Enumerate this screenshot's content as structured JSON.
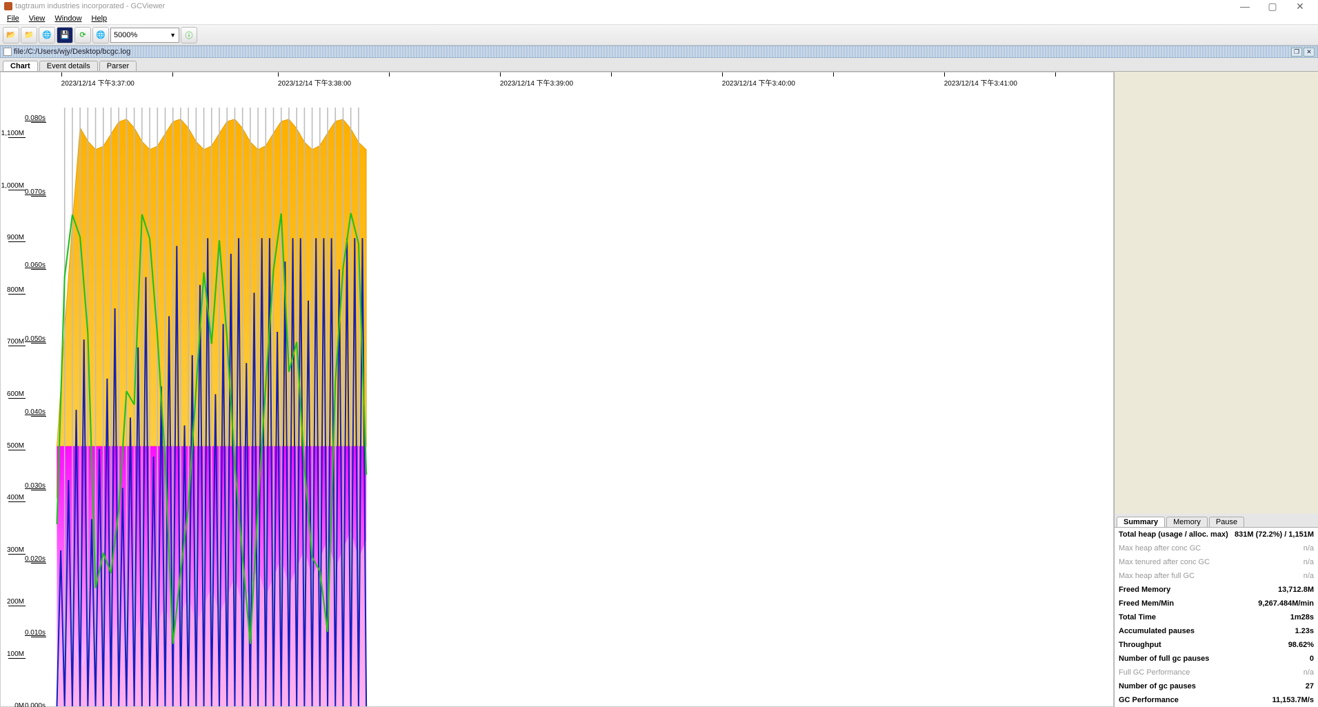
{
  "window": {
    "title": "tagtraum industries incorporated - GCViewer"
  },
  "menu": {
    "file": "File",
    "view": "View",
    "window": "Window",
    "help": "Help"
  },
  "toolbar": {
    "zoom_value": "5000%"
  },
  "subwin": {
    "path": "file:/C:/Users/wjy/Desktop/bcgc.log"
  },
  "chart_tabs": {
    "chart": "Chart",
    "event_details": "Event details",
    "parser": "Parser"
  },
  "right_tabs": {
    "summary": "Summary",
    "memory": "Memory",
    "pause": "Pause"
  },
  "summary": {
    "rows": [
      {
        "k": "Total heap (usage / alloc. max)",
        "v": "831M (72.2%) / 1,151M",
        "dim": false
      },
      {
        "k": "Max heap after conc GC",
        "v": "n/a",
        "dim": true
      },
      {
        "k": "Max tenured after conc GC",
        "v": "n/a",
        "dim": true
      },
      {
        "k": "Max heap after full GC",
        "v": "n/a",
        "dim": true
      },
      {
        "k": "Freed Memory",
        "v": "13,712.8M",
        "dim": false
      },
      {
        "k": "Freed Mem/Min",
        "v": "9,267.484M/min",
        "dim": false
      },
      {
        "k": "Total Time",
        "v": "1m28s",
        "dim": false
      },
      {
        "k": "Accumulated pauses",
        "v": "1.23s",
        "dim": false
      },
      {
        "k": "Throughput",
        "v": "98.62%",
        "dim": false
      },
      {
        "k": "Number of full gc pauses",
        "v": "0",
        "dim": false
      },
      {
        "k": "Full GC Performance",
        "v": "n/a",
        "dim": true
      },
      {
        "k": "Number of gc pauses",
        "v": "27",
        "dim": false
      },
      {
        "k": "GC Performance",
        "v": "11,153.7M/s",
        "dim": false
      }
    ]
  },
  "chart_data": {
    "type": "area+line",
    "x_axis": {
      "ticks": [
        {
          "pct": 0.5,
          "label": "2023/12/14 下午3:37:00"
        },
        {
          "pct": 21,
          "label": "2023/12/14 下午3:38:00"
        },
        {
          "pct": 42,
          "label": "2023/12/14 下午3:39:00"
        },
        {
          "pct": 63,
          "label": "2023/12/14 下午3:40:00"
        },
        {
          "pct": 84,
          "label": "2023/12/14 下午3:41:00"
        }
      ]
    },
    "y_left_mem": {
      "unit": "M",
      "range": [
        0,
        1200
      ],
      "ticks": [
        0,
        100,
        200,
        300,
        400,
        500,
        600,
        700,
        800,
        900,
        1000,
        1100
      ]
    },
    "y_right_time": {
      "unit": "s",
      "range": [
        0,
        0.085
      ],
      "ticks": [
        "0.000s",
        "0.010s",
        "0.020s",
        "0.030s",
        "0.040s",
        "0.050s",
        "0.060s",
        "0.070s",
        "0.080s"
      ]
    },
    "series": {
      "tenured_area_magenta": {
        "y_max_M": 500,
        "note": "fills bottom half, data covers x 0..30%"
      },
      "heap_area_yellow": {
        "y_max_M": 1151,
        "note": "upper area up to ~1100M, data covers x 0..30%"
      },
      "used_heap_blue_spikes": {
        "range_M": [
          0,
          900
        ]
      },
      "young_used_green": {
        "range_M": [
          100,
          1100
        ]
      },
      "data_x_extent_pct": 30
    }
  }
}
